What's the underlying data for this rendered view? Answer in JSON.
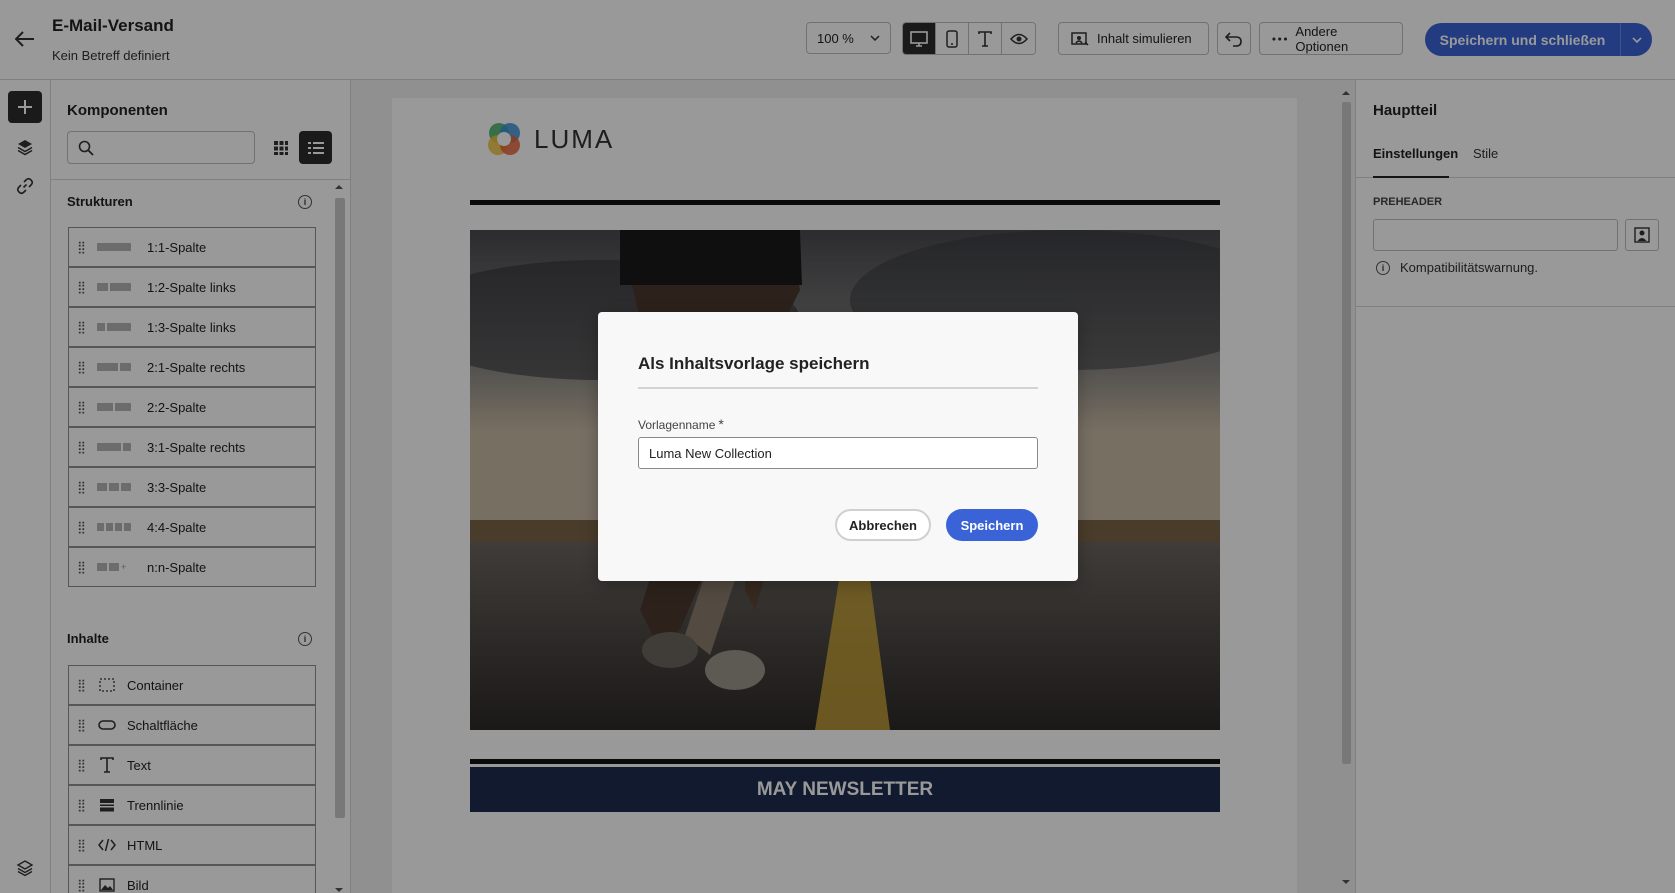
{
  "header": {
    "title": "E-Mail-Versand",
    "subtitle": "Kein Betreff definiert",
    "zoom": "100 %",
    "simulate_label": "Inhalt simulieren",
    "more_options_label": "Andere Optionen",
    "save_close_label": "Speichern und schließen"
  },
  "components": {
    "title": "Komponenten",
    "search_placeholder": "",
    "structures_heading": "Strukturen",
    "structures": [
      {
        "label": "1:1-Spalte"
      },
      {
        "label": "1:2-Spalte links"
      },
      {
        "label": "1:3-Spalte links"
      },
      {
        "label": "2:1-Spalte rechts"
      },
      {
        "label": "2:2-Spalte"
      },
      {
        "label": "3:1-Spalte rechts"
      },
      {
        "label": "3:3-Spalte"
      },
      {
        "label": "4:4-Spalte"
      },
      {
        "label": "n:n-Spalte"
      }
    ],
    "contents_heading": "Inhalte",
    "contents": [
      {
        "label": "Container",
        "icon": "container-icon"
      },
      {
        "label": "Schaltfläche",
        "icon": "button-icon"
      },
      {
        "label": "Text",
        "icon": "text-icon"
      },
      {
        "label": "Trennlinie",
        "icon": "divider-icon"
      },
      {
        "label": "HTML",
        "icon": "html-icon"
      },
      {
        "label": "Bild",
        "icon": "image-icon"
      }
    ]
  },
  "email": {
    "logo_text": "LUMA",
    "banner_text": "MAY NEWSLETTER"
  },
  "right_panel": {
    "title": "Hauptteil",
    "tabs": [
      "Einstellungen",
      "Stile"
    ],
    "preheader_label": "PREHEADER",
    "preheader_value": "",
    "warning": "Kompatibilitätswarnung."
  },
  "modal": {
    "title": "Als Inhaltsvorlage speichern",
    "field_label": "Vorlagenname",
    "required_mark": "*",
    "field_value": "Luma New Collection",
    "cancel_label": "Abbrechen",
    "save_label": "Speichern"
  },
  "colors": {
    "primary": "#3b63d8",
    "banner": "#1d2c4d"
  }
}
